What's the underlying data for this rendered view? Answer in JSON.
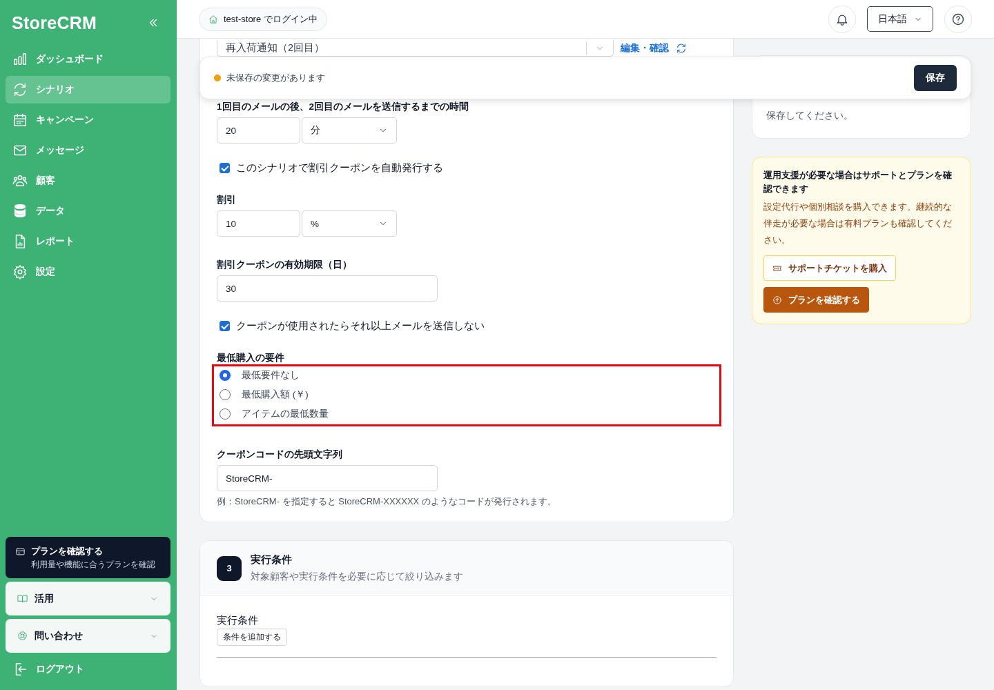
{
  "sidebar": {
    "logo": "StoreCRM",
    "items": [
      {
        "label": "ダッシュボード",
        "selected": false
      },
      {
        "label": "シナリオ",
        "selected": true
      },
      {
        "label": "キャンペーン",
        "selected": false
      },
      {
        "label": "メッセージ",
        "selected": false
      },
      {
        "label": "顧客",
        "selected": false
      },
      {
        "label": "データ",
        "selected": false
      },
      {
        "label": "レポート",
        "selected": false
      },
      {
        "label": "設定",
        "selected": false
      }
    ],
    "plan_card": {
      "title": "プランを確認する",
      "subtitle": "利用量や機能に合うプランを確認"
    },
    "sections": [
      {
        "label": "活用",
        "expanded": false
      },
      {
        "label": "問い合わせ",
        "expanded": false
      }
    ],
    "logout": "ログアウト"
  },
  "header": {
    "login_status": "test-store でログイン中",
    "language": "日本語"
  },
  "save_bar": {
    "message": "未保存の変更があります",
    "button": "保存"
  },
  "form": {
    "scenario_select": "再入荷通知（2回目）",
    "edit_link": "編集・確認",
    "fields": [
      {
        "kind": "number_unit",
        "label": "1回目のメールの後、2回目のメールを送信するまでの時間",
        "value": "20",
        "unit": "分"
      },
      {
        "kind": "checkbox",
        "label": "このシナリオで割引クーポンを自動発行する",
        "checked": true
      },
      {
        "kind": "number_unit",
        "label": "割引",
        "value": "10",
        "unit": "%"
      },
      {
        "kind": "text",
        "label": "割引クーポンの有効期限（日）",
        "value": "30"
      },
      {
        "kind": "checkbox",
        "label": "クーポンが使用されたらそれ以上メールを送信しない",
        "checked": true
      },
      {
        "kind": "radio_group",
        "label": "最低購入の要件",
        "highlighted": true,
        "options": [
          {
            "label": "最低要件なし",
            "selected": true
          },
          {
            "label": "最低購入額 (￥)",
            "selected": false
          },
          {
            "label": "アイテムの最低数量",
            "selected": false
          }
        ]
      },
      {
        "kind": "text",
        "label": "クーポンコードの先頭文字列",
        "value": "StoreCRM-",
        "hint": "例：StoreCRM- を指定すると StoreCRM-XXXXXX のようなコードが発行されます。"
      }
    ]
  },
  "conditions_section": {
    "step": "3",
    "title": "実行条件",
    "subtitle": "対象顧客や実行条件を必要に応じて絞り込みます",
    "label": "実行条件",
    "add_button": "条件を追加する"
  },
  "info_card": {
    "text": "保存してください。"
  },
  "support_card": {
    "title": "運用支援が必要な場合はサポートとプランを確認できます",
    "text": "設定代行や個別相談を購入できます。継続的な伴走が必要な場合は有料プランも確認してください。",
    "buttons": [
      {
        "label": "サポートチケットを購入",
        "kind": "outline"
      },
      {
        "label": "プランを確認する",
        "kind": "primary"
      }
    ]
  }
}
